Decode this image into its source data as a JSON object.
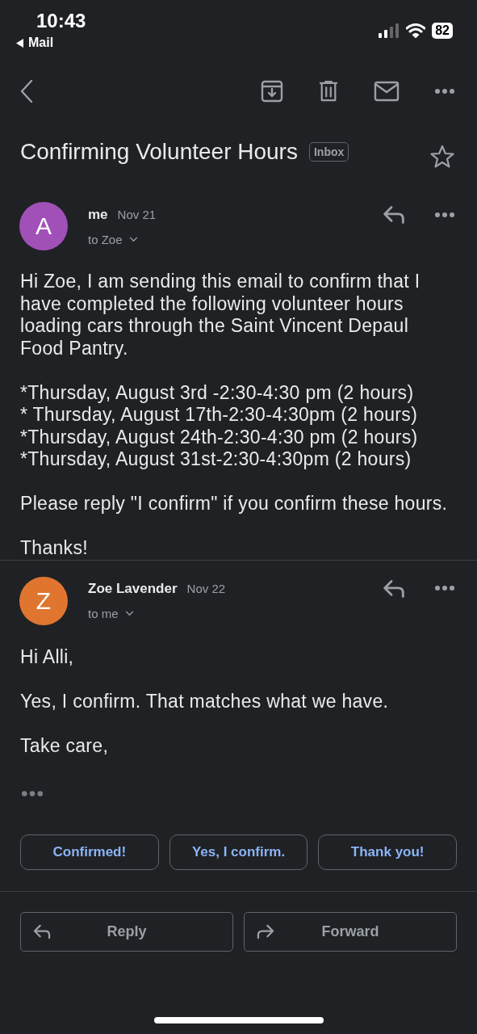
{
  "status_bar": {
    "time": "10:43",
    "back_label": "Mail",
    "battery": "82"
  },
  "subject": "Confirming Volunteer Hours",
  "label": "Inbox",
  "starred": false,
  "messages": [
    {
      "initial": "A",
      "color": "#a150b8",
      "sender": "me",
      "date": "Nov 21",
      "recipients": "to Zoe",
      "body": [
        "Hi Zoe, I am sending this email to confirm that I have completed the following volunteer hours loading cars through the Saint Vincent Depaul Food Pantry.",
        [
          "*Thursday, August 3rd -2:30-4:30 pm (2 hours)",
          "* Thursday, August 17th-2:30-4:30pm (2 hours)",
          "*Thursday, August 24th-2:30-4:30 pm (2 hours)",
          "*Thursday, August 31st-2:30-4:30pm (2 hours)"
        ],
        "Please reply \"I confirm\" if you confirm these hours.",
        "Thanks!"
      ],
      "trimmed": false
    },
    {
      "initial": "Z",
      "color": "#e07530",
      "sender": "Zoe Lavender",
      "date": "Nov 22",
      "recipients": "to me",
      "body": [
        "Hi Alli,",
        "Yes, I confirm. That matches what we have.",
        "Take care,"
      ],
      "trimmed": true
    }
  ],
  "smart_replies": [
    "Confirmed!",
    "Yes, I confirm.",
    "Thank you!"
  ],
  "actions": [
    {
      "kind": "reply",
      "label": "Reply"
    },
    {
      "kind": "forward",
      "label": "Forward"
    }
  ]
}
